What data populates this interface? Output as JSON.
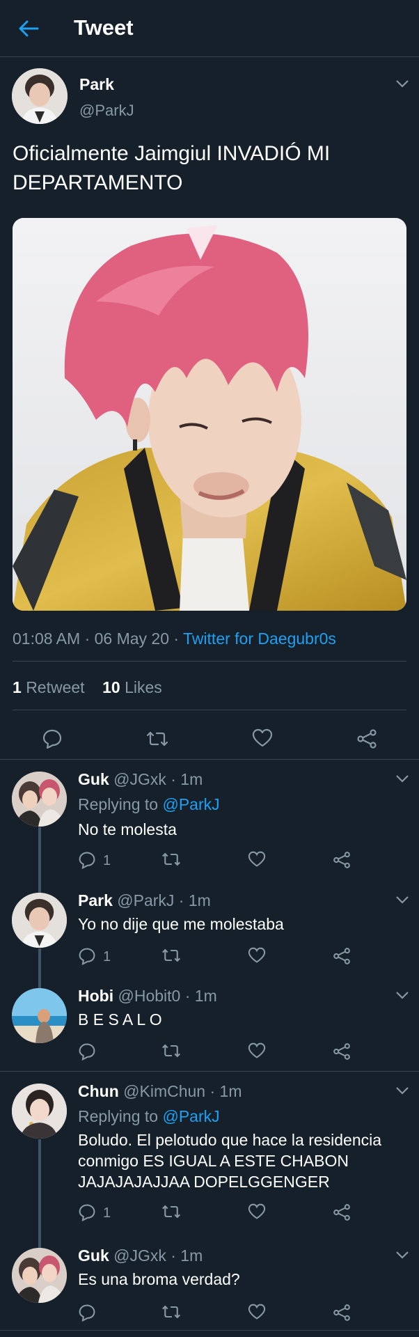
{
  "header": {
    "title": "Tweet",
    "back_icon": "arrow-left-icon",
    "accent": "#1da1f2"
  },
  "main_tweet": {
    "name": "Park",
    "handle": "@ParkJ",
    "text": "Oficialmente Jaimgiul INVADIÓ MI DEPARTAMENTO",
    "time": "01:08 AM · 06 May 20 · ",
    "source": "Twitter for Daegubr0s",
    "retweets_count": "1",
    "retweets_label": "Retweet",
    "likes_count": "10",
    "likes_label": "Likes"
  },
  "replies": [
    {
      "name": "Guk",
      "meta": "@JGxk · 1m",
      "replying_prefix": "Replying to ",
      "replying_to": "@ParkJ",
      "text": "No te molesta",
      "reply_count": "1"
    },
    {
      "name": "Park",
      "meta": "@ParkJ · 1m",
      "text": "Yo no dije que me molestaba",
      "reply_count": "1"
    },
    {
      "name": "Hobi",
      "meta": "@Hobit0 · 1m",
      "text": "B E S A L O",
      "reply_count": ""
    },
    {
      "name": "Chun",
      "meta": "@KimChun · 1m",
      "replying_prefix": "Replying to ",
      "replying_to": "@ParkJ",
      "text": "Boludo. El pelotudo que hace la residencia conmigo ES IGUAL A ESTE CHABON JAJAJAJAJJAA DOPELGGENGER",
      "reply_count": "1"
    },
    {
      "name": "Guk",
      "meta": "@JGxk · 1m",
      "text": "Es una broma verdad?",
      "reply_count": ""
    }
  ]
}
